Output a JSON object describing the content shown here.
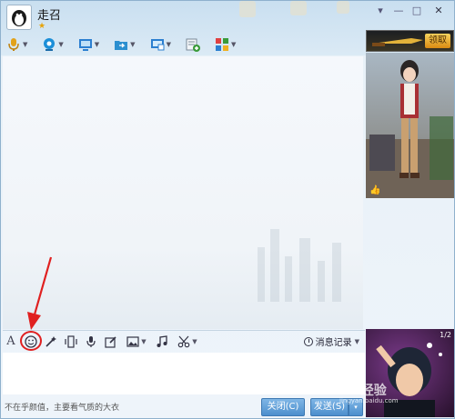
{
  "window": {
    "contact_name": "走召",
    "star": "★",
    "controls": {
      "menu": "▾",
      "minimize": "—",
      "maximize": "□",
      "close": "✕"
    }
  },
  "toolbar": {
    "items": [
      {
        "icon": "microphone-icon",
        "color": "#e2a21a"
      },
      {
        "icon": "webcam-icon",
        "color": "#1c8fd8"
      },
      {
        "icon": "screen-share-icon",
        "color": "#2b7fd0"
      },
      {
        "icon": "file-transfer-icon",
        "color": "#2b8fd0"
      },
      {
        "icon": "remote-desktop-icon",
        "color": "#2b7fd0"
      },
      {
        "icon": "create-group-icon",
        "color": "#3a9b3a"
      },
      {
        "icon": "apps-icon",
        "color": "#e04040"
      }
    ]
  },
  "ad": {
    "button_label": "领取"
  },
  "show_panel": {
    "pager": "1/2",
    "like_icon": "thumbs-up-icon"
  },
  "input_toolbar": {
    "font_label": "A",
    "history_label": "消息记录"
  },
  "footer": {
    "tip_text": "不在乎颜值，主要看气质的大衣",
    "close_button": "关闭(C)",
    "send_button": "发送(S)",
    "send_caret": "▾"
  },
  "watermark": {
    "brand": "Bai 经验",
    "url": "jingyan.baidu.com"
  },
  "colors": {
    "accent": "#4d8fcd",
    "annotation_red": "#e02020"
  }
}
